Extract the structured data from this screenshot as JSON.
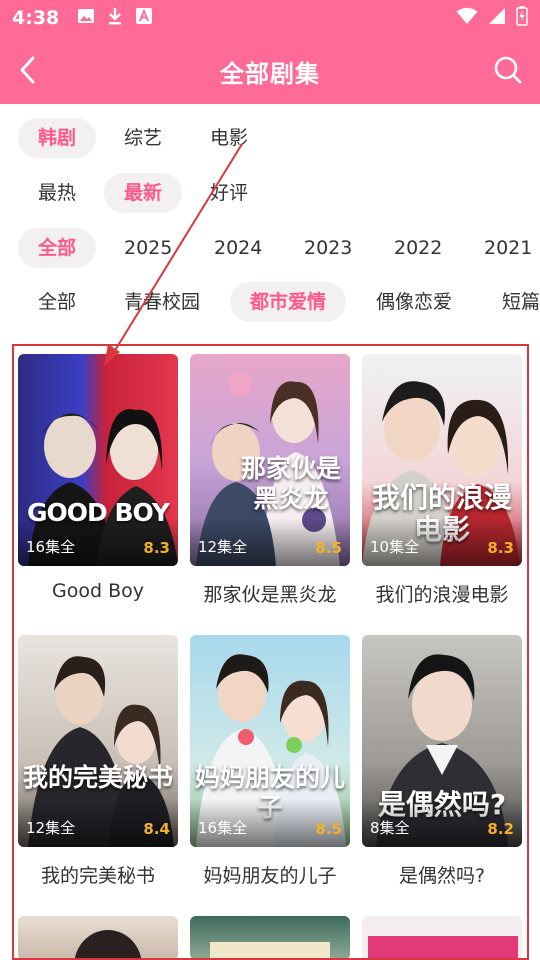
{
  "status_bar": {
    "time": "4:38",
    "left_icons": [
      "image-icon",
      "download-icon",
      "font-icon"
    ],
    "right_icons": [
      "wifi-icon",
      "signal-icon",
      "battery-charging-icon"
    ]
  },
  "header": {
    "title": "全部剧集",
    "back_icon": "chevron-left-icon",
    "search_icon": "search-icon"
  },
  "filters": {
    "region": {
      "items": [
        "韩剧",
        "综艺",
        "电影"
      ],
      "active": "韩剧"
    },
    "sort": {
      "items": [
        "最热",
        "最新",
        "好评"
      ],
      "active": "最新"
    },
    "year": {
      "items": [
        "全部",
        "2025",
        "2024",
        "2023",
        "2022",
        "2021"
      ],
      "active": "全部"
    },
    "genre": {
      "items": [
        "全部",
        "青春校园",
        "都市爱情",
        "偶像恋爱",
        "短篇"
      ],
      "active": "都市爱情"
    }
  },
  "shows": [
    {
      "title": "Good Boy",
      "episodes": "16集全",
      "score": "8.3",
      "poster_text": "GOOD BOY"
    },
    {
      "title": "那家伙是黑炎龙",
      "episodes": "12集全",
      "score": "8.5",
      "poster_text": "那家伙是黑炎龙"
    },
    {
      "title": "我们的浪漫电影",
      "episodes": "10集全",
      "score": "8.3",
      "poster_text": "我们的浪漫电影"
    },
    {
      "title": "我的完美秘书",
      "episodes": "12集全",
      "score": "8.4",
      "poster_text": "我的完美秘书"
    },
    {
      "title": "妈妈朋友的儿子",
      "episodes": "16集全",
      "score": "8.5",
      "poster_text": "妈妈朋友的儿子"
    },
    {
      "title": "是偶然吗?",
      "episodes": "8集全",
      "score": "8.2",
      "poster_text": "是偶然吗?"
    }
  ],
  "colors": {
    "brand": "#ff6a96",
    "active_text": "#ff5a8a",
    "score": "#f5b027",
    "annotation": "#d9363e"
  }
}
